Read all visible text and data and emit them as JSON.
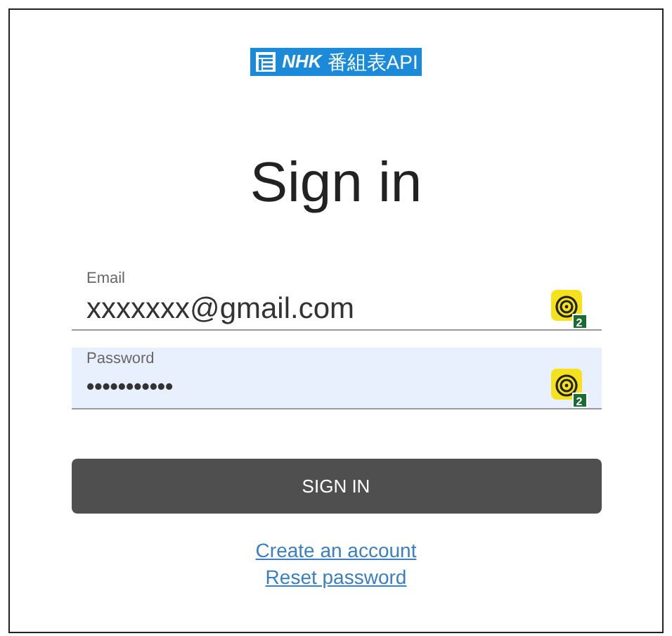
{
  "logo": {
    "brand": "NHK",
    "text": "番組表API"
  },
  "title": "Sign in",
  "fields": [
    {
      "label": "Email",
      "value": "xxxxxxx@gmail.com",
      "kind": "text",
      "autofilled": false,
      "badge": "2"
    },
    {
      "label": "Password",
      "value": "•••••••••••",
      "kind": "password",
      "autofilled": true,
      "badge": "2"
    }
  ],
  "button": "SIGN IN",
  "links": [
    "Create an account",
    "Reset password"
  ]
}
